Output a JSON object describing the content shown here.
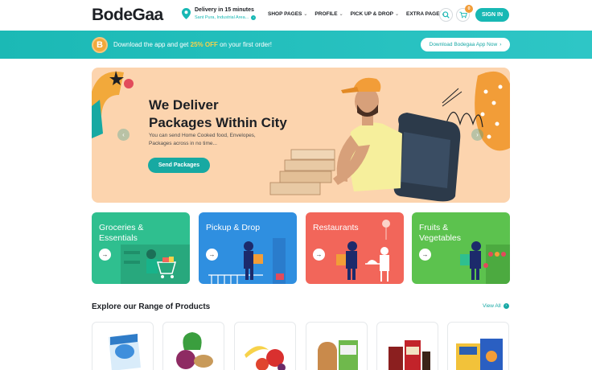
{
  "header": {
    "logo": "BodeGaa",
    "delivery_title": "Delivery in 15 minutes",
    "delivery_location": "Sant Pura, Industrial Area...",
    "nav": [
      {
        "label": "SHOP PAGES"
      },
      {
        "label": "PROFILE"
      },
      {
        "label": "PICK UP & DROP"
      },
      {
        "label": "EXTRA PAGE"
      }
    ],
    "cart_count": "0",
    "signin_label": "SIGN IN",
    "icons": [
      "location-pin-icon",
      "search-icon",
      "cart-icon"
    ]
  },
  "promo": {
    "badge": "B",
    "text_before": "Download the app and get ",
    "highlight": "25% OFF",
    "text_after": " on your first order!",
    "button_label": "Download Bodegaa App Now"
  },
  "hero": {
    "title_line1": "We Deliver",
    "title_line2": "Packages Within City",
    "subtitle": "You can send Home Cooked food, Envelopes, Packages across in no time...",
    "button_label": "Send Packages"
  },
  "categories": [
    {
      "title": "Groceries & Essentials",
      "color": "#2fbf8f"
    },
    {
      "title": "Pickup & Drop",
      "color": "#2f8fe0"
    },
    {
      "title": "Restaurants",
      "color": "#f2665a"
    },
    {
      "title": "Fruits & Vegetables",
      "color": "#5cc24e"
    }
  ],
  "products_section": {
    "title": "Explore our Range of Products",
    "view_all": "View All"
  },
  "colors": {
    "brand": "#17b8b4",
    "accent_orange": "#f2a93b",
    "hero_bg": "#fcd4ae"
  }
}
